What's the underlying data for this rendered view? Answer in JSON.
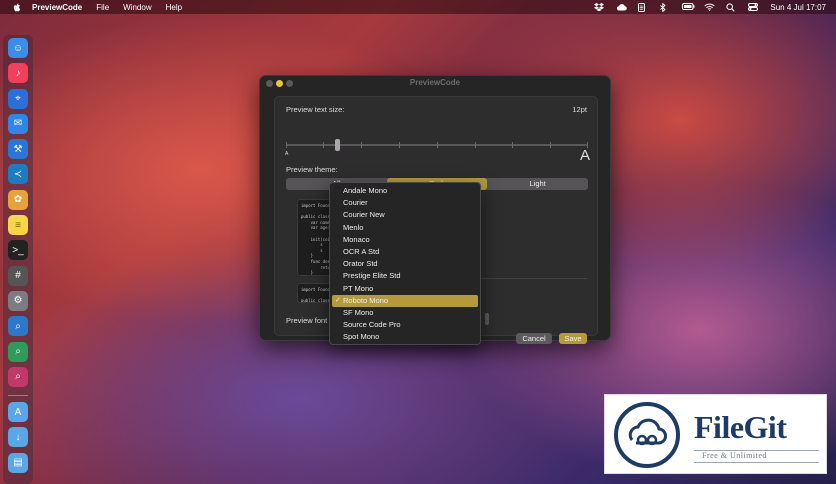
{
  "menubar": {
    "app_name": "PreviewCode",
    "items": [
      "File",
      "Window",
      "Help"
    ],
    "clock": "Sun 4 Jul  17:07"
  },
  "dock": {
    "apps": [
      {
        "icon": "finder-icon",
        "color": "#3a8ee6",
        "glyph": "☺"
      },
      {
        "icon": "music-icon",
        "color": "#f2405a",
        "glyph": "♪"
      },
      {
        "icon": "safari-icon",
        "color": "#2c6fd6",
        "glyph": "⌖"
      },
      {
        "icon": "mail-icon",
        "color": "#2f86e8",
        "glyph": "✉"
      },
      {
        "icon": "xcode-icon",
        "color": "#2a76d6",
        "glyph": "⚒"
      },
      {
        "icon": "vscode-icon",
        "color": "#1f7ac4",
        "glyph": "≺"
      },
      {
        "icon": "pixelmator-icon",
        "color": "#e8a23a",
        "glyph": "✿"
      },
      {
        "icon": "notes-icon",
        "color": "#f6d54a",
        "glyph": "≡"
      },
      {
        "icon": "terminal-icon",
        "color": "#222222",
        "glyph": ">_"
      },
      {
        "icon": "calculator-icon",
        "color": "#555555",
        "glyph": "#"
      },
      {
        "icon": "settings-icon",
        "color": "#7c7c84",
        "glyph": "⚙"
      },
      {
        "icon": "preview-code-icon",
        "color": "#2d78c8",
        "glyph": "⌕"
      },
      {
        "icon": "preview-markdown-icon",
        "color": "#2e9a5c",
        "glyph": "⌕"
      },
      {
        "icon": "preview-json-icon",
        "color": "#c2386b",
        "glyph": "⌕"
      }
    ],
    "folders": [
      {
        "icon": "applications-folder-icon",
        "color": "#5aa7e8",
        "glyph": "A"
      },
      {
        "icon": "downloads-folder-icon",
        "color": "#5aa7e8",
        "glyph": "↓"
      },
      {
        "icon": "documents-folder-icon",
        "color": "#5aa7e8",
        "glyph": "▤"
      }
    ]
  },
  "window": {
    "title": "PreviewCode",
    "text_size_label": "Preview text size:",
    "text_size_value": "12pt",
    "small_a": "A",
    "large_a": "A",
    "theme_label": "Preview theme:",
    "theme_tabs": [
      "All",
      "Dark",
      "Light"
    ],
    "theme_selected": "Dark",
    "hint_fragment": "ark",
    "font_label": "Preview font",
    "cancel_label": "Cancel",
    "save_label": "Save",
    "code_sample_1": "import Foundation\n\npublic class C\n    var name:\n    var age:\n\n    init(coi\n        s\n        s\n    }\n    func des\n        return\n    }\n}",
    "code_sample_2": "import Foundation\n\npublic class C"
  },
  "font_menu": {
    "options": [
      "Andale Mono",
      "Courier",
      "Courier New",
      "Menlo",
      "Monaco",
      "OCR A Std",
      "Orator Std",
      "Prestige Elite Std",
      "PT Mono",
      "Roboto Mono",
      "SF Mono",
      "Source Code Pro",
      "Spot Mono"
    ],
    "selected": "Roboto Mono",
    "check": "✓"
  },
  "watermark": {
    "name": "FileGit",
    "tagline": "Free & Unlimited"
  },
  "colors": {
    "accent": "#b59a3c",
    "window_bg": "#262526",
    "traffic_close": "#5b595b",
    "traffic_min": "#f2c23b",
    "traffic_max": "#5b595b"
  }
}
